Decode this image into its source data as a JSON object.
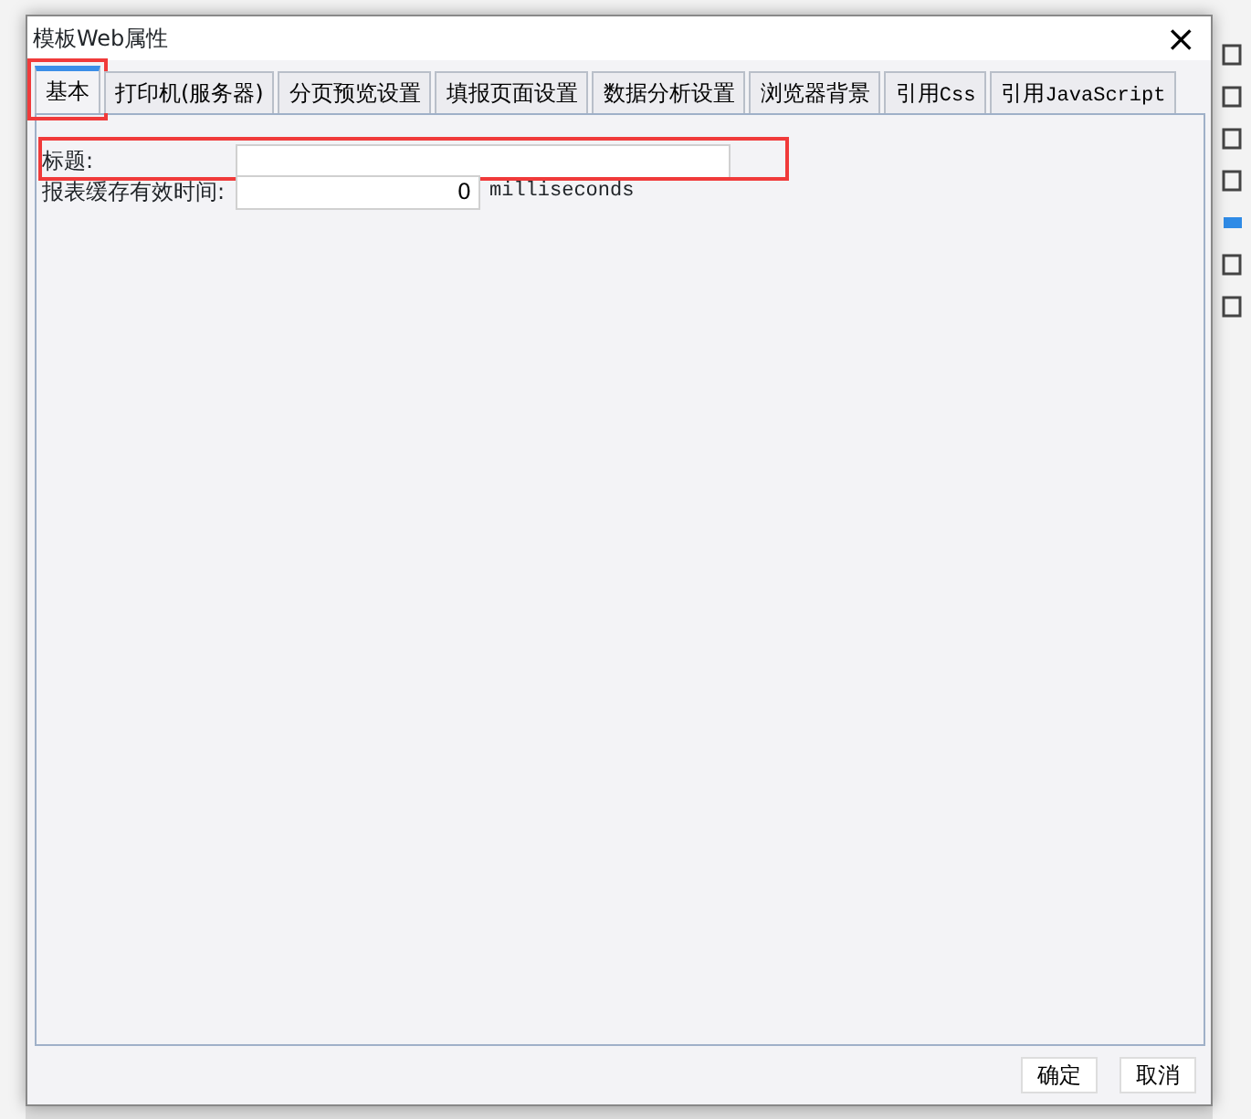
{
  "window": {
    "title": "模板Web属性",
    "close": "×"
  },
  "tabs": [
    {
      "label": "基本",
      "selected": true,
      "highlighted": true
    },
    {
      "label": "打印机(服务器)",
      "selected": false,
      "highlighted": false
    },
    {
      "label": "分页预览设置",
      "selected": false,
      "highlighted": false
    },
    {
      "label": "填报页面设置",
      "selected": false,
      "highlighted": false
    },
    {
      "label": "数据分析设置",
      "selected": false,
      "highlighted": false
    },
    {
      "label": "浏览器背景",
      "selected": false,
      "highlighted": false
    },
    {
      "label": "引用",
      "code": "Css",
      "selected": false,
      "highlighted": false
    },
    {
      "label": "引用",
      "code": "JavaScript",
      "selected": false,
      "highlighted": false
    }
  ],
  "fields": [
    {
      "label": "标题:",
      "highlighted": true
    },
    {
      "label": "报表缓存有效时间:",
      "value": "0",
      "unit": "milliseconds",
      "highlighted": false
    }
  ],
  "buttons": [
    "确定",
    "取消"
  ]
}
